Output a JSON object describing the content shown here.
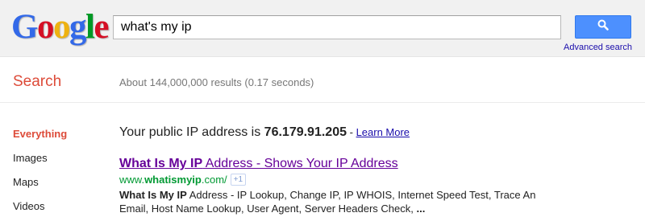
{
  "logo": {
    "letters": [
      {
        "char": "G",
        "color": "#3369e8"
      },
      {
        "char": "o",
        "color": "#d50f25"
      },
      {
        "char": "o",
        "color": "#eeb211"
      },
      {
        "char": "g",
        "color": "#3369e8"
      },
      {
        "char": "l",
        "color": "#009925"
      },
      {
        "char": "e",
        "color": "#d50f25"
      }
    ]
  },
  "search": {
    "query": "what's my ip",
    "button_icon": "search-icon",
    "advanced_link": "Advanced search"
  },
  "results_header": {
    "label": "Search",
    "stats": "About 144,000,000 results (0.17 seconds)"
  },
  "sidebar": {
    "items": [
      {
        "label": "Everything",
        "active": true
      },
      {
        "label": "Images",
        "active": false
      },
      {
        "label": "Maps",
        "active": false
      },
      {
        "label": "Videos",
        "active": false
      }
    ]
  },
  "ip_answer": {
    "prefix": "Your public IP address is ",
    "ip": "76.179.91.205",
    "separator": " - ",
    "learn_more": "Learn More"
  },
  "result": {
    "title_bold": "What Is My IP",
    "title_rest": " Address - Shows Your IP Address",
    "url_prefix": "www.",
    "url_bold": "whatismyip",
    "url_suffix": ".com/",
    "plus_one": "+1",
    "snippet_bold": "What Is My IP",
    "snippet_rest": " Address - IP Lookup, Change IP, IP WHOIS, Internet Speed Test, Trace An Email, Host Name Lookup, User Agent, Server Headers Check, ",
    "snippet_ellipsis": "..."
  },
  "colors": {
    "accent_red": "#dd4b39",
    "link_blue": "#1a0dab",
    "visited_purple": "#660099",
    "url_green": "#009933",
    "button_blue": "#4d90fe"
  }
}
